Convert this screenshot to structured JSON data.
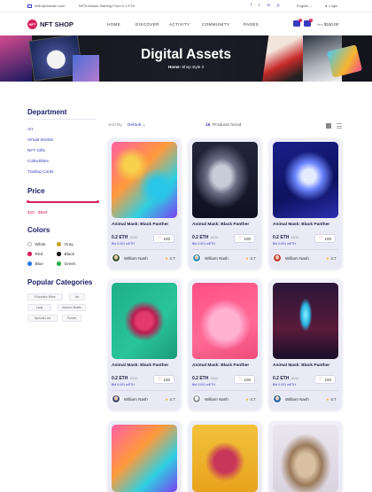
{
  "topbar": {
    "email": "hello@domain.com",
    "promo": "NFTs Assets Starting From 0.1 ETH",
    "social": [
      "f",
      "t",
      "in",
      "p"
    ],
    "language": "English",
    "login": "Login"
  },
  "brand": {
    "badge": "NFT",
    "name": "NFT SHOP"
  },
  "nav": [
    "HOME",
    "DISCOVER",
    "ACTIVITY",
    "COMMUNITY",
    "PAGES"
  ],
  "header": {
    "wishlist_count": "1",
    "cart_count": "1",
    "cart_label": "item",
    "cart_total": "$150.00"
  },
  "hero": {
    "title": "Digital Assets",
    "breadcrumb_home": "Home",
    "breadcrumb_sep": "›",
    "breadcrumb_current": "Shop style 3"
  },
  "sidebar": {
    "department_title": "Department",
    "departments": [
      "Art",
      "Virtual Worlds",
      "NFT Gifts",
      "Collectibles",
      "Trading Cards"
    ],
    "price_title": "Price",
    "price_range": "$10  -  $560",
    "colors_title": "Colors",
    "colors": [
      {
        "label": "White",
        "hex": "#ffffff"
      },
      {
        "label": "Gray",
        "hex": "#c9a227"
      },
      {
        "label": "Red",
        "hex": "#d8215c"
      },
      {
        "label": "Black",
        "hex": "#111111"
      },
      {
        "label": "Blue",
        "hex": "#2c7be5"
      },
      {
        "label": "Green",
        "hex": "#2bb24c"
      }
    ],
    "categories_title": "Popular Categories",
    "tags": [
      "Futuristic Wine",
      "Art",
      "Lady",
      "Alcohol Bottle",
      "Special Liar",
      "Puzzle"
    ]
  },
  "sortbar": {
    "sort_label": "Sort By",
    "sort_value": "Default ⌄",
    "count_number": "16",
    "count_text": "Products found"
  },
  "cards": [
    {
      "title": "Animal Mask: Black Panther",
      "price": "0.2 ETH",
      "stock": "10/10",
      "weth": "Bid 0.001 wETH",
      "likes": "100",
      "author": "William Nash",
      "rating": "4.7"
    },
    {
      "title": "Animal Mask: Black Panther",
      "price": "0.2 ETH",
      "stock": "10/10",
      "weth": "Bid 0.001 wETH",
      "likes": "100",
      "author": "William Nash",
      "rating": "4.7"
    },
    {
      "title": "Animal Mask: Black Panther",
      "price": "0.2 ETH",
      "stock": "10/10",
      "weth": "Bid 0.001 wETH",
      "likes": "100",
      "author": "William Nash",
      "rating": "4.7"
    },
    {
      "title": "Animal Mask: Black Panther",
      "price": "0.2 ETH",
      "stock": "10/10",
      "weth": "Bid 0.001 wETH",
      "likes": "100",
      "author": "William Nash",
      "rating": "4.7"
    },
    {
      "title": "Animal Mask: Black Panther",
      "price": "0.2 ETH",
      "stock": "10/10",
      "weth": "Bid 0.001 wETH",
      "likes": "100",
      "author": "William Nash",
      "rating": "4.7"
    },
    {
      "title": "Animal Mask: Black Panther",
      "price": "0.2 ETH",
      "stock": "10/10",
      "weth": "Bid 0.001 wETH",
      "likes": "100",
      "author": "William Nash",
      "rating": "4.7"
    }
  ],
  "colors": {
    "accent": "#3b3bbf",
    "brand": "#d8215c",
    "navy": "#1b1b6a"
  }
}
